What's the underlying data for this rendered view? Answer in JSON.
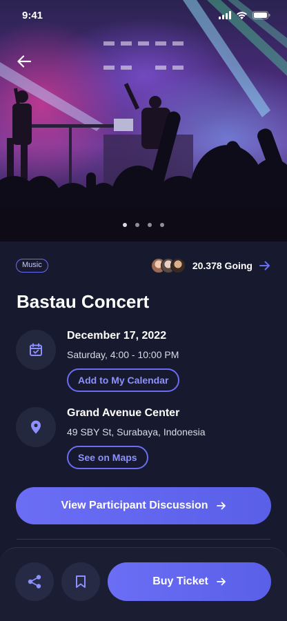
{
  "status_bar": {
    "time": "9:41"
  },
  "event": {
    "category": "Music",
    "going_count": "20.378 Going",
    "title": "Bastau Concert"
  },
  "date_info": {
    "date": "December 17, 2022",
    "time": "Saturday, 4:00 - 10:00 PM",
    "action": "Add to My Calendar"
  },
  "location_info": {
    "venue": "Grand Avenue Center",
    "address": "49 SBY St, Surabaya, Indonesia",
    "action": "See on Maps"
  },
  "discussion_button": "View Participant Discussion",
  "bottom_bar": {
    "buy_button": "Buy Ticket"
  },
  "carousel": {
    "page_count": 4,
    "active_index": 0
  },
  "colors": {
    "background": "#171a2e",
    "accent": "#6b6ef5",
    "accent_text": "#8d90ff",
    "surface": "#24283f"
  },
  "icons": {
    "back": "arrow-left-icon",
    "calendar": "calendar-check-icon",
    "location": "map-pin-icon",
    "share": "share-icon",
    "bookmark": "bookmark-icon",
    "arrow": "arrow-right-icon"
  }
}
